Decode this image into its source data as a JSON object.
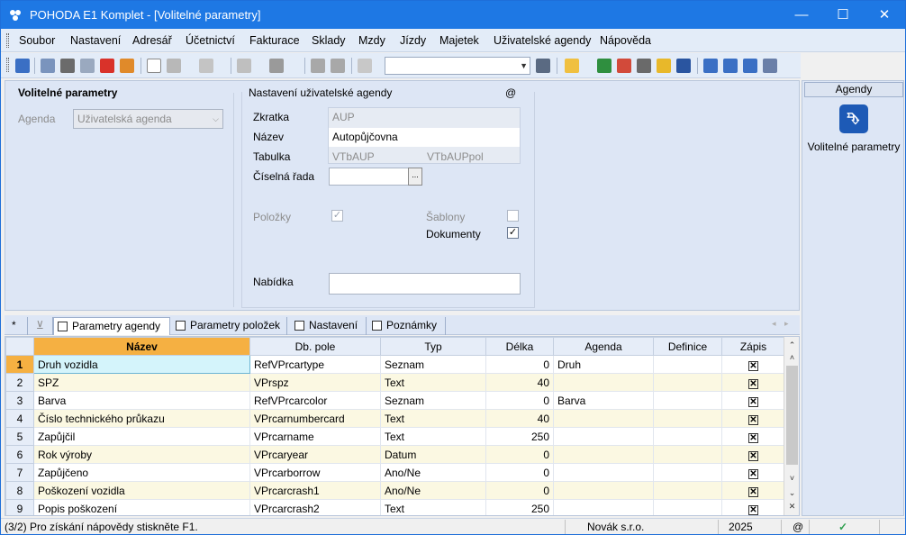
{
  "window": {
    "title": "POHODA E1 Komplet - [Volitelné parametry]",
    "minimize": "—",
    "maximize": "☐",
    "close": "✕"
  },
  "menu": [
    "Soubor",
    "Nastavení",
    "Adresář",
    "Účetnictví",
    "Fakturace",
    "Sklady",
    "Mzdy",
    "Jízdy",
    "Majetek",
    "Uživatelské agendy",
    "Nápověda"
  ],
  "left_section": {
    "title": "Volitelné parametry",
    "agenda_label": "Agenda",
    "agenda_value": "Uživatelská agenda"
  },
  "user_agenda": {
    "title": "Nastavení uživatelské agendy",
    "at_symbol": "@",
    "zkratka_label": "Zkratka",
    "zkratka_value": "AUP",
    "nazev_label": "Název",
    "nazev_value": "Autopůjčovna",
    "tabulka_label": "Tabulka",
    "tabulka_value1": "VTbAUP",
    "tabulka_value2": "VTbAUPpol",
    "ciselna_rada_label": "Číselná řada",
    "ciselna_rada_value": "",
    "ciselna_rada_btn": "...",
    "polozky_label": "Položky",
    "polozky_checked": "✓",
    "sablony_label": "Šablony",
    "sablony_checked": "",
    "dokumenty_label": "Dokumenty",
    "dokumenty_checked": "✓",
    "nabidka_label": "Nabídka",
    "nabidka_value": ""
  },
  "sidebar": {
    "header": "Agendy",
    "icon_glyph": "⮷",
    "item_label": "Volitelné parametry"
  },
  "tabs": {
    "star": "*",
    "filter": "⊻",
    "items": [
      "Parametry agendy",
      "Parametry položek",
      "Nastavení",
      "Poznámky"
    ]
  },
  "grid": {
    "headers": [
      "Název",
      "Db. pole",
      "Typ",
      "Délka",
      "Agenda",
      "Definice",
      "Zápis"
    ],
    "rows": [
      {
        "n": "1",
        "name": "Druh vozidla",
        "db": "RefVPrcartype",
        "typ": "Seznam",
        "delka": "0",
        "agenda": "Druh",
        "definice": "",
        "zapis": "✕"
      },
      {
        "n": "2",
        "name": "SPZ",
        "db": "VPrspz",
        "typ": "Text",
        "delka": "40",
        "agenda": "",
        "definice": "",
        "zapis": "✕"
      },
      {
        "n": "3",
        "name": "Barva",
        "db": "RefVPrcarcolor",
        "typ": "Seznam",
        "delka": "0",
        "agenda": "Barva",
        "definice": "",
        "zapis": "✕"
      },
      {
        "n": "4",
        "name": "Číslo technického průkazu",
        "db": "VPrcarnumbercard",
        "typ": "Text",
        "delka": "40",
        "agenda": "",
        "definice": "",
        "zapis": "✕"
      },
      {
        "n": "5",
        "name": "Zapůjčil",
        "db": "VPrcarname",
        "typ": "Text",
        "delka": "250",
        "agenda": "",
        "definice": "",
        "zapis": "✕"
      },
      {
        "n": "6",
        "name": "Rok výroby",
        "db": "VPrcaryear",
        "typ": "Datum",
        "delka": "0",
        "agenda": "",
        "definice": "",
        "zapis": "✕"
      },
      {
        "n": "7",
        "name": "Zapůjčeno",
        "db": "VPrcarborrow",
        "typ": "Ano/Ne",
        "delka": "0",
        "agenda": "",
        "definice": "",
        "zapis": "✕"
      },
      {
        "n": "8",
        "name": "Poškození vozidla",
        "db": "VPrcarcrash1",
        "typ": "Ano/Ne",
        "delka": "0",
        "agenda": "",
        "definice": "",
        "zapis": "✕"
      },
      {
        "n": "9",
        "name": "Popis poškození",
        "db": "VPrcarcrash2",
        "typ": "Text",
        "delka": "250",
        "agenda": "",
        "definice": "",
        "zapis": "✕"
      }
    ]
  },
  "status": {
    "help": "(3/2) Pro získání nápovědy stiskněte F1.",
    "company": "Novák s.r.o.",
    "year": "2025",
    "at": "@",
    "check": "✓"
  },
  "colors": {
    "titlebar": "#1e78e4",
    "panel": "#dde6f5",
    "selected_header": "#f5b042",
    "alt_row": "#fbf8e2"
  }
}
